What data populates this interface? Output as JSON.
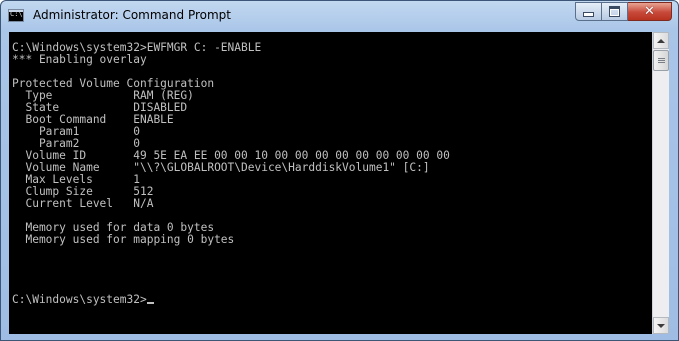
{
  "window": {
    "title": "Administrator: Command Prompt",
    "app_icon_text": "C:\\"
  },
  "console": {
    "lines": [
      "C:\\Windows\\system32>EWFMGR C: -ENABLE",
      "*** Enabling overlay",
      "",
      "Protected Volume Configuration",
      "  Type            RAM (REG)",
      "  State           DISABLED",
      "  Boot Command    ENABLE",
      "    Param1        0",
      "    Param2        0",
      "  Volume ID       49 5E EA EE 00 00 10 00 00 00 00 00 00 00 00 00",
      "  Volume Name     \"\\\\?\\GLOBALROOT\\Device\\HarddiskVolume1\" [C:]",
      "  Max Levels      1",
      "  Clump Size      512",
      "  Current Level   N/A",
      "",
      "  Memory used for data 0 bytes",
      "  Memory used for mapping 0 bytes",
      "",
      "",
      "",
      ""
    ],
    "prompt": "C:\\Windows\\system32>"
  },
  "colors": {
    "console_background": "#000000",
    "console_text": "#c0c0c0"
  }
}
